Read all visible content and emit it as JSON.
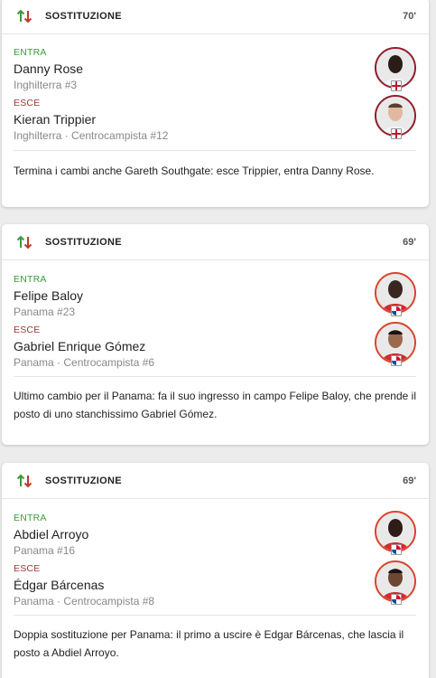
{
  "labels": {
    "in": "ENTRA",
    "out": "ESCE"
  },
  "colors": {
    "in_arrow": "#3c9a3c",
    "out_arrow": "#c0392b",
    "england_ring": "#8e1f2b",
    "panama_ring": "#d9442b"
  },
  "cards": [
    {
      "title": "SOSTITUZIONE",
      "minute": "70'",
      "in_player": {
        "name": "Danny Rose",
        "meta": "Inghilterra #3",
        "flag": "england-flag-icon"
      },
      "out_player": {
        "name": "Kieran Trippier",
        "meta": "Inghilterra · Centrocampista #12",
        "flag": "england-flag-icon"
      },
      "comment": "Termina i cambi anche Gareth Southgate: esce Trippier, entra Danny Rose."
    },
    {
      "title": "SOSTITUZIONE",
      "minute": "69'",
      "in_player": {
        "name": "Felipe Baloy",
        "meta": "Panama #23",
        "flag": "panama-flag-icon"
      },
      "out_player": {
        "name": "Gabriel Enrique Gómez",
        "meta": "Panama · Centrocampista #6",
        "flag": "panama-flag-icon"
      },
      "comment": "Ultimo cambio per il Panama: fa il suo ingresso in campo Felipe Baloy, che prende il posto di uno stanchissimo Gabriel Gómez."
    },
    {
      "title": "SOSTITUZIONE",
      "minute": "69'",
      "in_player": {
        "name": "Abdiel Arroyo",
        "meta": "Panama #16",
        "flag": "panama-flag-icon"
      },
      "out_player": {
        "name": "Édgar Bárcenas",
        "meta": "Panama · Centrocampista #8",
        "flag": "panama-flag-icon"
      },
      "comment": "Doppia sostituzione per Panama: il primo a uscire è Edgar Bárcenas, che lascia il posto a Abdiel Arroyo."
    }
  ]
}
